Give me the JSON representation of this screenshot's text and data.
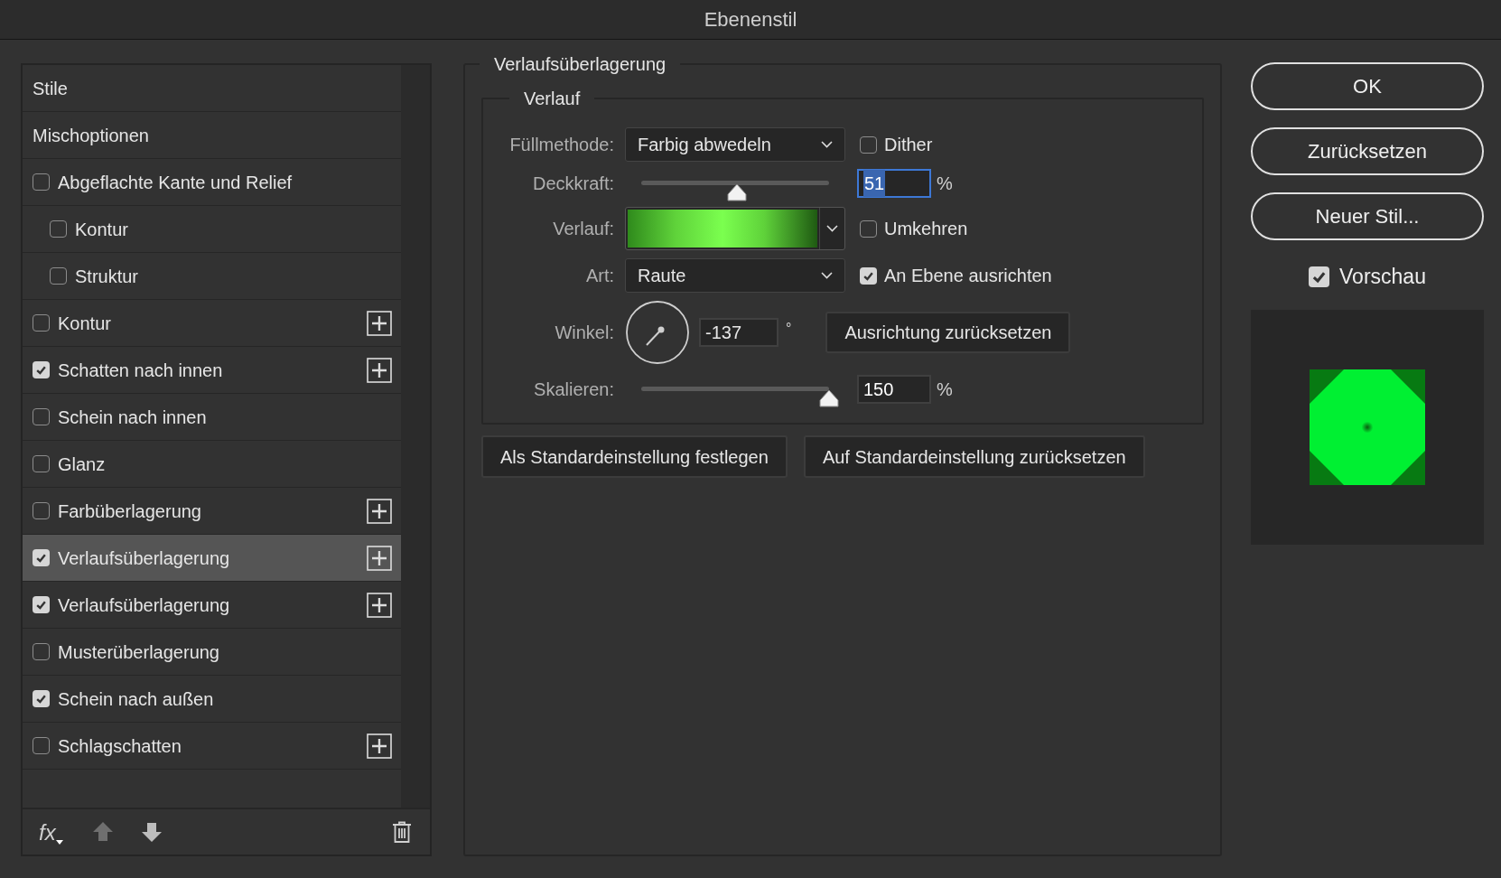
{
  "window": {
    "title": "Ebenenstil"
  },
  "styles_list": {
    "items": [
      {
        "kind": "header",
        "label": "Stile",
        "selected": false
      },
      {
        "kind": "header",
        "label": "Mischoptionen",
        "selected": false
      },
      {
        "kind": "check",
        "label": "Abgeflachte Kante und Relief",
        "checked": false,
        "selected": false,
        "add": false,
        "children": [
          {
            "kind": "check",
            "label": "Kontur",
            "checked": false,
            "selected": false,
            "add": false
          },
          {
            "kind": "check",
            "label": "Struktur",
            "checked": false,
            "selected": false,
            "add": false
          }
        ]
      },
      {
        "kind": "check",
        "label": "Kontur",
        "checked": false,
        "selected": false,
        "add": true
      },
      {
        "kind": "check",
        "label": "Schatten nach innen",
        "checked": true,
        "selected": false,
        "add": true
      },
      {
        "kind": "check",
        "label": "Schein nach innen",
        "checked": false,
        "selected": false,
        "add": false
      },
      {
        "kind": "check",
        "label": "Glanz",
        "checked": false,
        "selected": false,
        "add": false
      },
      {
        "kind": "check",
        "label": "Farbüberlagerung",
        "checked": false,
        "selected": false,
        "add": true
      },
      {
        "kind": "check",
        "label": "Verlaufsüberlagerung",
        "checked": true,
        "selected": true,
        "add": true
      },
      {
        "kind": "check",
        "label": "Verlaufsüberlagerung",
        "checked": true,
        "selected": false,
        "add": true
      },
      {
        "kind": "check",
        "label": "Musterüberlagerung",
        "checked": false,
        "selected": false,
        "add": false
      },
      {
        "kind": "check",
        "label": "Schein nach außen",
        "checked": true,
        "selected": false,
        "add": false
      },
      {
        "kind": "check",
        "label": "Schlagschatten",
        "checked": false,
        "selected": false,
        "add": true
      }
    ],
    "footer": {
      "fx_label": "fx"
    }
  },
  "gradient_overlay": {
    "title": "Verlaufsüberlagerung",
    "group_title": "Verlauf",
    "blend_mode": {
      "label": "Füllmethode:",
      "value": "Farbig abwedeln"
    },
    "dither": {
      "label": "Dither",
      "checked": false
    },
    "opacity": {
      "label": "Deckkraft:",
      "level": 0.51,
      "value": "51",
      "unit": "%",
      "highlighted": true
    },
    "gradient": {
      "label": "Verlauf:"
    },
    "reverse": {
      "label": "Umkehren",
      "checked": false
    },
    "style": {
      "label": "Art:",
      "value": "Raute"
    },
    "align": {
      "label": "An Ebene ausrichten",
      "checked": true
    },
    "angle": {
      "label": "Winkel:",
      "value": "-137",
      "unit": "°"
    },
    "reset_alignment": "Ausrichtung zurücksetzen",
    "scale": {
      "label": "Skalieren:",
      "level": 1,
      "value": "150",
      "unit": "%",
      "highlighted": false
    },
    "buttons": [
      "Als Standardeinstellung festlegen",
      "Auf Standardeinstellung zurücksetzen"
    ]
  },
  "actions": [
    "OK",
    "Zurücksetzen",
    "Neuer Stil..."
  ],
  "preview": {
    "label": "Vorschau",
    "checked": true
  }
}
